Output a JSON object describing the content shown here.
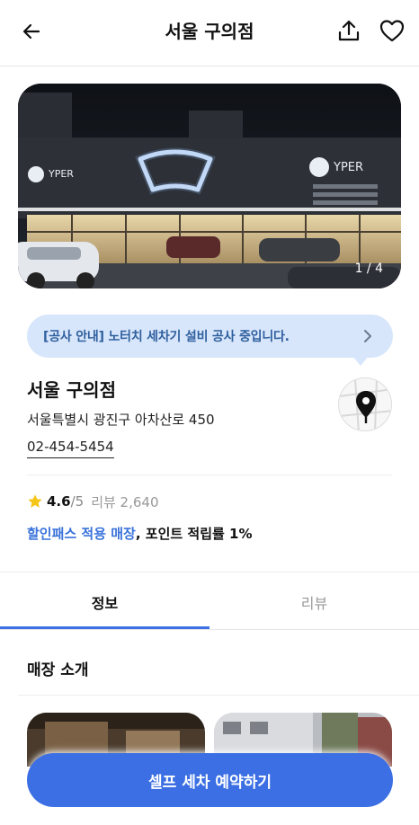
{
  "header": {
    "title": "서울 구의점",
    "back_icon": "arrow-left-icon",
    "share_icon": "share-upload-icon",
    "favorite_icon": "heart-outline-icon"
  },
  "gallery": {
    "counter": "1 / 4",
    "sign_text": "YPER"
  },
  "notice": {
    "text": "[공사 안내] 노터치 세차기 설비 공사 중입니다.",
    "icon": "chevron-right-icon"
  },
  "store": {
    "name": "서울 구의점",
    "address": "서울특별시 광진구 아차산로 450",
    "phone": "02-454-5454",
    "map_icon": "map-pin-icon"
  },
  "rating": {
    "score": "4.6",
    "max": "/5",
    "reviews_label": "리뷰 2,640",
    "star_color": "#f5c518"
  },
  "benefit": {
    "highlight": "할인패스 적용 매장",
    "rest": ", 포인트 적립률 1%"
  },
  "tabs": [
    {
      "label": "정보",
      "active": true
    },
    {
      "label": "리뷰",
      "active": false
    }
  ],
  "intro": {
    "title": "매장 소개"
  },
  "cta": {
    "label": "셀프 세차 예약하기"
  },
  "colors": {
    "accent": "#3b6fe3",
    "notice_bg": "#d7e6fb",
    "notice_text": "#2f5f9e",
    "link_blue": "#3a73db"
  }
}
